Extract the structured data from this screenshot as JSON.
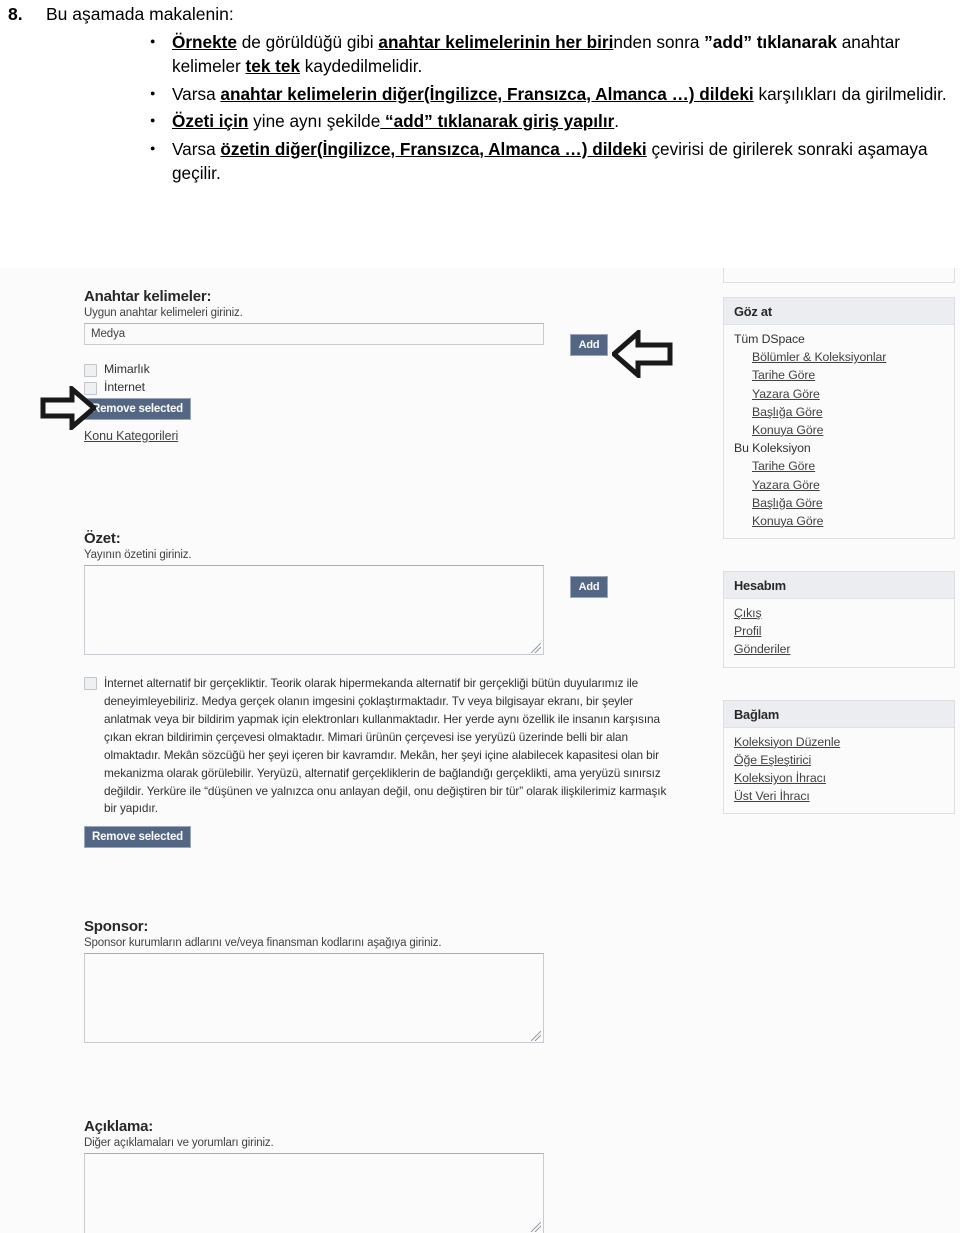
{
  "document": {
    "number": "8.",
    "intro": "Bu aşamada makalenin:",
    "bullets": [
      {
        "parts": [
          {
            "t": "Örnekte",
            "s": "bu"
          },
          {
            "t": " de görüldüğü gibi ",
            "s": "n"
          },
          {
            "t": "anahtar kelimelerinin her biri",
            "s": "bu"
          },
          {
            "t": "nden sonra ",
            "s": "n"
          },
          {
            "t": "”add” tıklanarak",
            "s": "b"
          },
          {
            "t": " anahtar kelimeler ",
            "s": "n"
          },
          {
            "t": "tek tek",
            "s": "bu"
          },
          {
            "t": " kaydedilmelidir.",
            "s": "n"
          }
        ]
      },
      {
        "parts": [
          {
            "t": "Varsa ",
            "s": "n"
          },
          {
            "t": "anahtar kelimelerin diğer(İngilizce, Fransızca, Almanca …) dildeki",
            "s": "bu"
          },
          {
            "t": " karşılıkları da girilmelidir.",
            "s": "n"
          }
        ]
      },
      {
        "parts": [
          {
            "t": "Özeti için",
            "s": "bu"
          },
          {
            "t": " yine aynı şekilde",
            "s": "n"
          },
          {
            "t": " “add” tıklanarak giriş yapılır",
            "s": "bu"
          },
          {
            "t": ".",
            "s": "n"
          }
        ]
      },
      {
        "parts": [
          {
            "t": "Varsa ",
            "s": "n"
          },
          {
            "t": "özetin diğer(İngilizce, Fransızca, Almanca …) dildeki",
            "s": "bu"
          },
          {
            "t": " çevirisi de girilerek sonraki aşamaya geçilir.",
            "s": "n"
          }
        ]
      }
    ]
  },
  "screenshot": {
    "keywords": {
      "label": "Anahtar kelimeler:",
      "hint": "Uygun anahtar kelimeleri giriniz.",
      "input_value": "Medya",
      "add_label": "Add",
      "checkboxes": [
        {
          "label": "Mimarlık",
          "checked": false
        },
        {
          "label": "İnternet",
          "checked": false
        }
      ],
      "remove_label": "Remove selected",
      "category_link": "Konu Kategorileri"
    },
    "abstract": {
      "label": "Özet:",
      "hint": "Yayının özetini giriniz.",
      "textarea_value": "",
      "add_label": "Add",
      "entry_text": "İnternet alternatif bir gerçekliktir. Teorik olarak hipermekanda alternatif bir gerçekliği bütün duyularımız ile deneyimleyebiliriz. Medya gerçek olanın imgesini çoklaştırmaktadır. Tv veya bilgisayar ekranı, bir şeyler anlatmak veya bir bildirim yapmak için elektronları kullanmaktadır. Her yerde aynı özellik ile insanın karşısına çıkan ekran bildirimin çerçevesi olmaktadır. Mimari ürünün çerçevesi ise yeryüzü üzerinde belli bir alan olmaktadır. Mekân sözcüğü her şeyi içeren bir kavramdır. Mekân, her şeyi içine alabilecek kapasitesi olan bir mekanizma olarak görülebilir. Yeryüzü, alternatif gerçekliklerin de bağlandığı gerçeklikti, ama yeryüzü sınırsız değildir. Yerküre ile “düşünen ve yalnızca onu anlayan değil, onu değiştiren bir tür” olarak ilişkilerimiz karmaşık bir yapıdır.",
      "remove_label": "Remove selected"
    },
    "sponsor": {
      "label": "Sponsor:",
      "hint": "Sponsor kurumların adlarını ve/veya finansman kodlarını aşağıya giriniz.",
      "textarea_value": ""
    },
    "description": {
      "label": "Açıklama:",
      "hint": "Diğer açıklamaları ve yorumları giriniz.",
      "textarea_value": ""
    },
    "sidebar": {
      "browse": {
        "title": "Göz at",
        "groups": [
          {
            "group_label": "Tüm DSpace",
            "links": [
              "Bölümler & Koleksiyonlar",
              "Tarihe Göre",
              "Yazara Göre",
              "Başlığa Göre",
              "Konuya Göre"
            ]
          },
          {
            "group_label": "Bu Koleksiyon",
            "links": [
              "Tarihe Göre",
              "Yazara Göre",
              "Başlığa Göre",
              "Konuya Göre"
            ]
          }
        ]
      },
      "account": {
        "title": "Hesabım",
        "links": [
          "Çıkış",
          "Profil",
          "Gönderiler"
        ]
      },
      "context": {
        "title": "Bağlam",
        "links": [
          "Koleksiyon Düzenle",
          "Öğe Eşleştirici",
          "Koleksiyon İhracı",
          "Üst Veri İhracı"
        ]
      }
    },
    "annotations": [
      {
        "name": "arrow-pointing-left-at-add-button",
        "direction": "left"
      },
      {
        "name": "arrow-pointing-right-at-keyword-list",
        "direction": "right"
      }
    ]
  },
  "colors": {
    "button_blue": "#4e6281",
    "sidebar_header_gray": "#eef0f3",
    "border_gray": "#dfe2e6"
  }
}
